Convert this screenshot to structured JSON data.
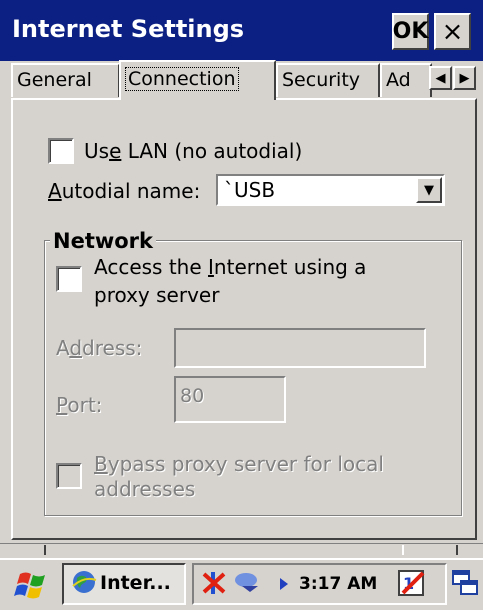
{
  "window": {
    "title": "Internet Settings",
    "ok_label": "OK",
    "close_label": "×"
  },
  "tabs": [
    {
      "label": "General",
      "active": false
    },
    {
      "label": "Connection",
      "active": true
    },
    {
      "label": "Security",
      "active": false
    },
    {
      "label": "Ad",
      "active": false
    }
  ],
  "tab_scroll": {
    "left": "◀",
    "right": "▶"
  },
  "connection": {
    "use_lan": {
      "label_pre": "Us",
      "label_key": "e",
      "label_post": " LAN (no autodial)",
      "checked": false
    },
    "autodial": {
      "label_key": "A",
      "label_post": "utodial name:",
      "value": "`USB",
      "arrow": "▼"
    }
  },
  "network": {
    "title": "Network",
    "proxy_checkbox": {
      "label_pre": "Access the ",
      "label_key": "I",
      "label_post": "nternet using a",
      "label_line2": "proxy server",
      "checked": false
    },
    "address": {
      "label_pre": "A",
      "label_key": "d",
      "label_post": "dress:",
      "value": ""
    },
    "port": {
      "label_key": "P",
      "label_post": "ort:",
      "value": "80"
    },
    "bypass": {
      "label_key": "B",
      "label_post": "ypass proxy server for local",
      "label_line2": "addresses",
      "checked": false,
      "enabled": false
    }
  },
  "taskbar": {
    "task_label": "Inter...",
    "clock": "3:17 AM",
    "colors": {
      "start_red": "#e03020",
      "start_blue": "#2050d0",
      "start_green": "#20a020",
      "start_yellow": "#f0c000"
    }
  }
}
